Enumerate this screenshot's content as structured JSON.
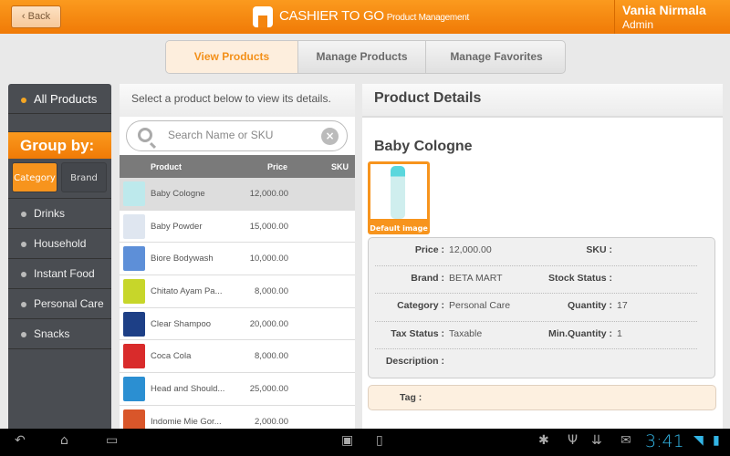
{
  "header": {
    "back_label": "Back",
    "app_title": "CASHIER TO GO",
    "app_subtitle": "Product Management",
    "user_name": "Vania Nirmala",
    "user_role": "Admin",
    "accent": "#f7941d"
  },
  "tabs": [
    {
      "label": "View Products",
      "active": true
    },
    {
      "label": "Manage Products",
      "active": false
    },
    {
      "label": "Manage Favorites",
      "active": false
    }
  ],
  "sidebar": {
    "all_products": "All Products",
    "group_by": "Group by:",
    "group_buttons": [
      {
        "label": "Category",
        "active": true
      },
      {
        "label": "Brand",
        "active": false
      }
    ],
    "categories": [
      "Drinks",
      "Household",
      "Instant Food",
      "Personal Care",
      "Snacks"
    ]
  },
  "list": {
    "hint": "Select a product below to view its details.",
    "search_placeholder": "Search Name or SKU",
    "columns": {
      "product": "Product",
      "price": "Price",
      "sku": "SKU"
    },
    "rows": [
      {
        "name": "Baby Cologne",
        "price": "12,000.00",
        "selected": true,
        "color": "#bde9ec"
      },
      {
        "name": "Baby Powder",
        "price": "15,000.00",
        "color": "#dfe6f0"
      },
      {
        "name": "Biore Bodywash",
        "price": "10,000.00",
        "color": "#5d8fd8"
      },
      {
        "name": "Chitato Ayam Pa...",
        "price": "8,000.00",
        "color": "#c7d62a"
      },
      {
        "name": "Clear Shampoo",
        "price": "20,000.00",
        "color": "#1d3f86"
      },
      {
        "name": "Coca Cola",
        "price": "8,000.00",
        "color": "#d92b2b"
      },
      {
        "name": "Head and Should...",
        "price": "25,000.00",
        "color": "#2b8fd2"
      },
      {
        "name": "Indomie Mie Gor...",
        "price": "2,000.00",
        "color": "#d9562a"
      }
    ]
  },
  "details": {
    "header": "Product Details",
    "name": "Baby Cologne",
    "image_label": "Default image",
    "fields": [
      {
        "k1": "Price :",
        "v1": "12,000.00",
        "k2": "SKU :",
        "v2": ""
      },
      {
        "k1": "Brand :",
        "v1": "BETA MART",
        "k2": "Stock Status :",
        "v2": ""
      },
      {
        "k1": "Category :",
        "v1": "Personal Care",
        "k2": "Quantity :",
        "v2": "17"
      },
      {
        "k1": "Tax Status :",
        "v1": "Taxable",
        "k2": "Min.Quantity :",
        "v2": "1"
      },
      {
        "k1": "Description :",
        "v1": "",
        "k2": "",
        "v2": ""
      }
    ],
    "tag_label": "Tag :"
  },
  "statusbar": {
    "time": "3:41"
  }
}
